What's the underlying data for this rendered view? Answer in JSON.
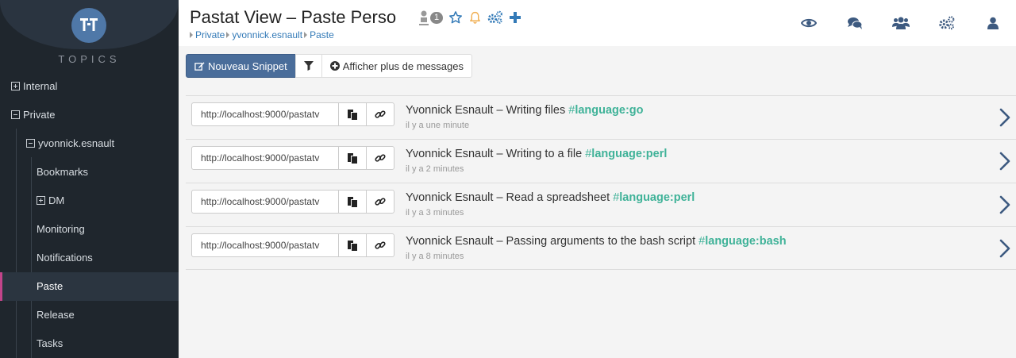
{
  "colors": {
    "sidebar_bg": "#1f262d",
    "accent": "#4a6d9a",
    "active_marker": "#c2448a",
    "tag": "#3fb298",
    "star": "#337ab7",
    "bell": "#f0ad4e"
  },
  "sidebar": {
    "logo_text": "TAT",
    "brand": "TOPICS",
    "items": [
      {
        "label": "Internal",
        "toggle": "plus"
      },
      {
        "label": "Private",
        "toggle": "minus"
      },
      {
        "label": "yvonnick.esnault",
        "toggle": "minus"
      },
      {
        "label": "Bookmarks"
      },
      {
        "label": "DM",
        "toggle": "plus"
      },
      {
        "label": "Monitoring"
      },
      {
        "label": "Notifications"
      },
      {
        "label": "Paste",
        "active": true
      },
      {
        "label": "Release"
      },
      {
        "label": "Tasks"
      }
    ]
  },
  "header": {
    "title": "Pastat View – Paste Perso",
    "user_count": "1",
    "breadcrumb": [
      "Private",
      "yvonnick.esnault",
      "Paste"
    ],
    "title_icons": [
      "user-icon",
      "star-icon",
      "bell-icon",
      "settings-icon",
      "plus-icon"
    ],
    "top_nav_icons": [
      "eye-icon",
      "comments-icon",
      "group-icon",
      "cogs-icon",
      "user-icon"
    ]
  },
  "toolbar": {
    "new_snippet": "Nouveau Snippet",
    "filter_icon": "filter-icon",
    "more_messages": "Afficher plus de messages"
  },
  "messages": [
    {
      "url": "http://localhost:9000/pastatv",
      "title": "Yvonnick Esnault – Writing files",
      "tag_hash": "#",
      "tag": "language:go",
      "time": "il y a une minute"
    },
    {
      "url": "http://localhost:9000/pastatv",
      "title": "Yvonnick Esnault – Writing to a file",
      "tag_hash": "#",
      "tag": "language:perl",
      "time": "il y a 2 minutes"
    },
    {
      "url": "http://localhost:9000/pastatv",
      "title": "Yvonnick Esnault – Read a spreadsheet",
      "tag_hash": "#",
      "tag": "language:perl",
      "time": "il y a 3 minutes"
    },
    {
      "url": "http://localhost:9000/pastatv",
      "title": "Yvonnick Esnault – Passing arguments to the bash script",
      "tag_hash": "#",
      "tag": "language:bash",
      "time": "il y a 8 minutes"
    }
  ]
}
